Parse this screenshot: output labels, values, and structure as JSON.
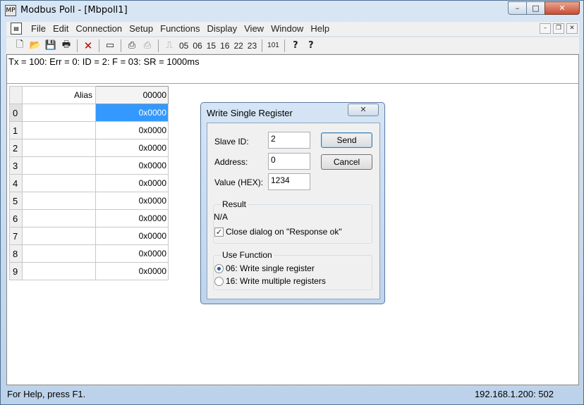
{
  "window": {
    "title": "Modbus Poll - [Mbpoll1]",
    "app_icon_glyph": "MP",
    "controls": {
      "minimize": "–",
      "maximize": "□",
      "close": "✕"
    }
  },
  "menu": {
    "items": [
      "File",
      "Edit",
      "Connection",
      "Setup",
      "Functions",
      "Display",
      "View",
      "Window",
      "Help"
    ],
    "mdi_controls": {
      "minimize": "–",
      "restore": "❐",
      "close": "✕"
    }
  },
  "toolbar": {
    "icons": [
      "new-icon",
      "open-icon",
      "save-icon",
      "print-icon",
      "delete-icon",
      "window-icon",
      "connect-icon",
      "disconnect-icon",
      "pulse-icon"
    ],
    "function_codes": [
      "05",
      "06",
      "15",
      "16",
      "22",
      "23"
    ],
    "binary_label": "101",
    "help_glyph": "?",
    "context_help_glyph": "?"
  },
  "status_line": "Tx = 100: Err = 0: ID = 2: F = 03: SR = 1000ms",
  "grid": {
    "header_alias": "Alias",
    "header_address": "00000",
    "rows": [
      {
        "index": "0",
        "alias": "",
        "value": "0x0000"
      },
      {
        "index": "1",
        "alias": "",
        "value": "0x0000"
      },
      {
        "index": "2",
        "alias": "",
        "value": "0x0000"
      },
      {
        "index": "3",
        "alias": "",
        "value": "0x0000"
      },
      {
        "index": "4",
        "alias": "",
        "value": "0x0000"
      },
      {
        "index": "5",
        "alias": "",
        "value": "0x0000"
      },
      {
        "index": "6",
        "alias": "",
        "value": "0x0000"
      },
      {
        "index": "7",
        "alias": "",
        "value": "0x0000"
      },
      {
        "index": "8",
        "alias": "",
        "value": "0x0000"
      },
      {
        "index": "9",
        "alias": "",
        "value": "0x0000"
      }
    ],
    "selected_row": 0,
    "selection_color": "#3399ff"
  },
  "dialog": {
    "title": "Write Single Register",
    "close_glyph": "✕",
    "slave_id_label": "Slave ID:",
    "slave_id_value": "2",
    "address_label": "Address:",
    "address_value": "0",
    "value_label": "Value (HEX):",
    "value_value": "1234",
    "send_label": "Send",
    "cancel_label": "Cancel",
    "result_group_label": "Result",
    "result_text": "N/A",
    "close_on_response_label": "Close dialog on \"Response ok\"",
    "close_on_response_checked": true,
    "use_function_label": "Use Function",
    "function_options": [
      {
        "label": "06: Write single register",
        "selected": true
      },
      {
        "label": "16: Write multiple registers",
        "selected": false
      }
    ]
  },
  "statusbar": {
    "help_text": "For Help, press F1.",
    "connection": "192.168.1.200: 502"
  }
}
